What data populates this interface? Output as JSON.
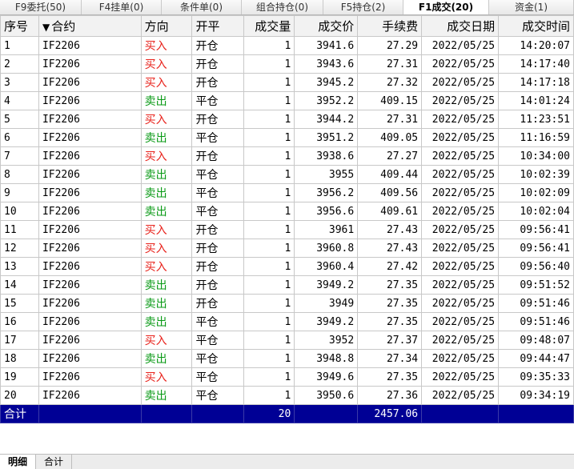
{
  "tabs": [
    {
      "label": "F9委托(50)",
      "active": false
    },
    {
      "label": "F4挂单(0)",
      "active": false
    },
    {
      "label": "条件单(0)",
      "active": false
    },
    {
      "label": "组合持仓(0)",
      "active": false
    },
    {
      "label": "F5持仓(2)",
      "active": false
    },
    {
      "label": "F1成交(20)",
      "active": true
    },
    {
      "label": "资金(1)",
      "active": false
    }
  ],
  "columns": {
    "seq": "序号",
    "contract": "合约",
    "direction": "方向",
    "offset": "开平",
    "qty": "成交量",
    "price": "成交价",
    "fee": "手续费",
    "date": "成交日期",
    "time": "成交时间"
  },
  "rows": [
    {
      "seq": "1",
      "contract": "IF2206",
      "direction": "买入",
      "offset": "开仓",
      "qty": "1",
      "price": "3941.6",
      "fee": "27.29",
      "date": "2022/05/25",
      "time": "14:20:07"
    },
    {
      "seq": "2",
      "contract": "IF2206",
      "direction": "买入",
      "offset": "开仓",
      "qty": "1",
      "price": "3943.6",
      "fee": "27.31",
      "date": "2022/05/25",
      "time": "14:17:40"
    },
    {
      "seq": "3",
      "contract": "IF2206",
      "direction": "买入",
      "offset": "开仓",
      "qty": "1",
      "price": "3945.2",
      "fee": "27.32",
      "date": "2022/05/25",
      "time": "14:17:18"
    },
    {
      "seq": "4",
      "contract": "IF2206",
      "direction": "卖出",
      "offset": "平仓",
      "qty": "1",
      "price": "3952.2",
      "fee": "409.15",
      "date": "2022/05/25",
      "time": "14:01:24"
    },
    {
      "seq": "5",
      "contract": "IF2206",
      "direction": "买入",
      "offset": "开仓",
      "qty": "1",
      "price": "3944.2",
      "fee": "27.31",
      "date": "2022/05/25",
      "time": "11:23:51"
    },
    {
      "seq": "6",
      "contract": "IF2206",
      "direction": "卖出",
      "offset": "平仓",
      "qty": "1",
      "price": "3951.2",
      "fee": "409.05",
      "date": "2022/05/25",
      "time": "11:16:59"
    },
    {
      "seq": "7",
      "contract": "IF2206",
      "direction": "买入",
      "offset": "开仓",
      "qty": "1",
      "price": "3938.6",
      "fee": "27.27",
      "date": "2022/05/25",
      "time": "10:34:00"
    },
    {
      "seq": "8",
      "contract": "IF2206",
      "direction": "卖出",
      "offset": "平仓",
      "qty": "1",
      "price": "3955",
      "fee": "409.44",
      "date": "2022/05/25",
      "time": "10:02:39"
    },
    {
      "seq": "9",
      "contract": "IF2206",
      "direction": "卖出",
      "offset": "平仓",
      "qty": "1",
      "price": "3956.2",
      "fee": "409.56",
      "date": "2022/05/25",
      "time": "10:02:09"
    },
    {
      "seq": "10",
      "contract": "IF2206",
      "direction": "卖出",
      "offset": "平仓",
      "qty": "1",
      "price": "3956.6",
      "fee": "409.61",
      "date": "2022/05/25",
      "time": "10:02:04"
    },
    {
      "seq": "11",
      "contract": "IF2206",
      "direction": "买入",
      "offset": "开仓",
      "qty": "1",
      "price": "3961",
      "fee": "27.43",
      "date": "2022/05/25",
      "time": "09:56:41"
    },
    {
      "seq": "12",
      "contract": "IF2206",
      "direction": "买入",
      "offset": "开仓",
      "qty": "1",
      "price": "3960.8",
      "fee": "27.43",
      "date": "2022/05/25",
      "time": "09:56:41"
    },
    {
      "seq": "13",
      "contract": "IF2206",
      "direction": "买入",
      "offset": "开仓",
      "qty": "1",
      "price": "3960.4",
      "fee": "27.42",
      "date": "2022/05/25",
      "time": "09:56:40"
    },
    {
      "seq": "14",
      "contract": "IF2206",
      "direction": "卖出",
      "offset": "开仓",
      "qty": "1",
      "price": "3949.2",
      "fee": "27.35",
      "date": "2022/05/25",
      "time": "09:51:52"
    },
    {
      "seq": "15",
      "contract": "IF2206",
      "direction": "卖出",
      "offset": "开仓",
      "qty": "1",
      "price": "3949",
      "fee": "27.35",
      "date": "2022/05/25",
      "time": "09:51:46"
    },
    {
      "seq": "16",
      "contract": "IF2206",
      "direction": "卖出",
      "offset": "平仓",
      "qty": "1",
      "price": "3949.2",
      "fee": "27.35",
      "date": "2022/05/25",
      "time": "09:51:46"
    },
    {
      "seq": "17",
      "contract": "IF2206",
      "direction": "买入",
      "offset": "平仓",
      "qty": "1",
      "price": "3952",
      "fee": "27.37",
      "date": "2022/05/25",
      "time": "09:48:07"
    },
    {
      "seq": "18",
      "contract": "IF2206",
      "direction": "卖出",
      "offset": "平仓",
      "qty": "1",
      "price": "3948.8",
      "fee": "27.34",
      "date": "2022/05/25",
      "time": "09:44:47"
    },
    {
      "seq": "19",
      "contract": "IF2206",
      "direction": "买入",
      "offset": "平仓",
      "qty": "1",
      "price": "3949.6",
      "fee": "27.35",
      "date": "2022/05/25",
      "time": "09:35:33"
    },
    {
      "seq": "20",
      "contract": "IF2206",
      "direction": "卖出",
      "offset": "平仓",
      "qty": "1",
      "price": "3950.6",
      "fee": "27.36",
      "date": "2022/05/25",
      "time": "09:34:19"
    }
  ],
  "total": {
    "label": "合计",
    "qty": "20",
    "fee": "2457.06"
  },
  "bottom_tabs": [
    {
      "label": "明细",
      "active": true
    },
    {
      "label": "合计",
      "active": false
    }
  ],
  "colors": {
    "buy": "#e8221b",
    "sell": "#0a9a16",
    "total_bg": "#000095"
  },
  "icons": {
    "filter": "filter-icon"
  }
}
